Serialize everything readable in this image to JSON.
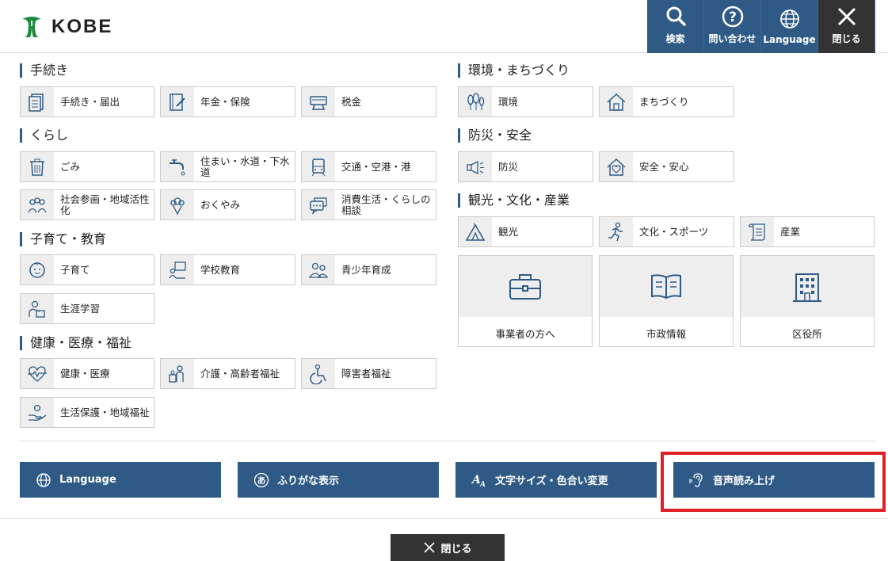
{
  "header": {
    "logo_text": "KOBE",
    "buttons": [
      {
        "label": "検索",
        "icon": "search-icon"
      },
      {
        "label": "問い合わせ",
        "icon": "question-icon"
      },
      {
        "label": "Language",
        "icon": "globe-icon"
      },
      {
        "label": "閉じる",
        "icon": "close-icon"
      }
    ]
  },
  "left": {
    "sections": [
      {
        "title": "手続き",
        "items": [
          "手続き・届出",
          "年金・保険",
          "税金"
        ]
      },
      {
        "title": "くらし",
        "items": [
          "ごみ",
          "住まい・水道・下水道",
          "交通・空港・港",
          "社会参画・地域活性化",
          "おくやみ",
          "消費生活・くらしの相談"
        ]
      },
      {
        "title": "子育て・教育",
        "items": [
          "子育て",
          "学校教育",
          "青少年育成",
          "生涯学習"
        ]
      },
      {
        "title": "健康・医療・福祉",
        "items": [
          "健康・医療",
          "介護・高齢者福祉",
          "障害者福祉",
          "生活保護・地域福祉"
        ]
      }
    ]
  },
  "right": {
    "sections": [
      {
        "title": "環境・まちづくり",
        "items": [
          "環境",
          "まちづくり"
        ]
      },
      {
        "title": "防災・安全",
        "items": [
          "防災",
          "安全・安心"
        ]
      },
      {
        "title": "観光・文化・産業",
        "items": [
          "観光",
          "文化・スポーツ",
          "産業"
        ]
      }
    ],
    "big_tiles": [
      "事業者の方へ",
      "市政情報",
      "区役所"
    ]
  },
  "bottom_buttons": [
    {
      "label": "Language",
      "icon": "globe-icon"
    },
    {
      "label": "ふりがな表示",
      "icon": "hiragana-icon"
    },
    {
      "label": "文字サイズ・色合い変更",
      "icon": "font-size-icon"
    },
    {
      "label": "音声読み上げ",
      "icon": "ear-icon"
    }
  ],
  "footer": {
    "close_label": "閉じる"
  },
  "colors": {
    "primary": "#2e5a85",
    "dark": "#333333",
    "highlight": "#e01e25",
    "logo_green": "#1a8a3c"
  }
}
